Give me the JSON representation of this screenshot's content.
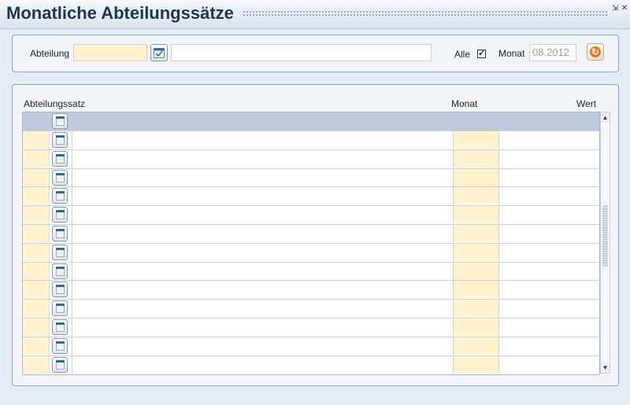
{
  "window": {
    "title": "Monatliche Abteilungssätze",
    "pin_glyph": "⇲",
    "close_glyph": "✕"
  },
  "filter": {
    "abteilung_label": "Abteilung",
    "abteilung_code": "",
    "abteilung_name": "",
    "alle_label": "Alle",
    "alle_checked": true,
    "alle_check_glyph": "✓",
    "monat_label": "Monat",
    "monat_value": "08.2012",
    "refresh_glyph": "↻"
  },
  "grid": {
    "columns": {
      "abteilungssatz": "Abteilungssatz",
      "monat": "Monat",
      "wert": "Wert"
    },
    "rows": [
      {
        "name": "",
        "monat": "",
        "wert": ""
      },
      {
        "name": "",
        "monat": "",
        "wert": ""
      },
      {
        "name": "",
        "monat": "",
        "wert": ""
      },
      {
        "name": "",
        "monat": "",
        "wert": ""
      },
      {
        "name": "",
        "monat": "",
        "wert": ""
      },
      {
        "name": "",
        "monat": "",
        "wert": ""
      },
      {
        "name": "",
        "monat": "",
        "wert": ""
      },
      {
        "name": "",
        "monat": "",
        "wert": ""
      },
      {
        "name": "",
        "monat": "",
        "wert": ""
      },
      {
        "name": "",
        "monat": "",
        "wert": ""
      },
      {
        "name": "",
        "monat": "",
        "wert": ""
      },
      {
        "name": "",
        "monat": "",
        "wert": ""
      },
      {
        "name": "",
        "monat": "",
        "wert": ""
      }
    ],
    "scroll_up_glyph": "▲",
    "scroll_down_glyph": "▼"
  },
  "colors": {
    "title": "#1f3550",
    "mandatory_field": "#fff2cc",
    "panel_border": "#8aa5c4",
    "refresh_accent": "#f2701b"
  },
  "icons": {
    "picker": "calendar-check-icon",
    "row_button": "document-icon",
    "refresh": "refresh-icon"
  }
}
